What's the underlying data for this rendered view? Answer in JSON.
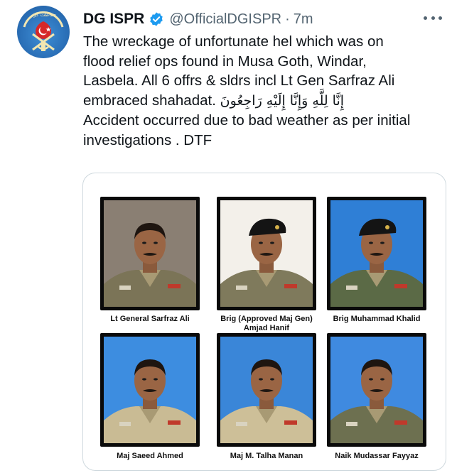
{
  "tweet": {
    "author_name": "DG ISPR",
    "handle": "@OfficialDGISPR",
    "separator": "·",
    "time": "7m",
    "verified": true,
    "text_lines": [
      "The wreckage of unfortunate hel which was on",
      "flood relief ops found in Musa Goth, Windar,",
      "Lasbela. All 6 offrs & sldrs incl Lt Gen Sarfraz Ali",
      "embraced shahadat.",
      "Accident occurred due to bad weather as per initial",
      "investigations . DTF"
    ],
    "arabic_text": "إِنَّا لِلَّهِ وَإِنَّا إِلَيْهِ رَاجِعُونَ"
  },
  "avatar": {
    "icon": "isp-crest-icon",
    "top_arc_text": "حفاظت کرم"
  },
  "media": {
    "photos": [
      {
        "caption_lines": [
          "Lt General Sarfraz Ali"
        ],
        "background": "#8a7f73",
        "uniform": "#7b7457",
        "headwear": "none"
      },
      {
        "caption_lines": [
          "Brig (Approved Maj Gen)",
          "Amjad Hanif"
        ],
        "background": "#f3f0ea",
        "uniform": "#7f7a5c",
        "headwear": "beret"
      },
      {
        "caption_lines": [
          "Brig Muhammad Khalid"
        ],
        "background": "#2f7fd6",
        "uniform": "#5b6a46",
        "headwear": "beret"
      },
      {
        "caption_lines": [
          "Maj Saeed Ahmed"
        ],
        "background": "#3d8de0",
        "uniform": "#c9bb94",
        "headwear": "none"
      },
      {
        "caption_lines": [
          "Maj M. Talha Manan"
        ],
        "background": "#3a86d8",
        "uniform": "#cdbf98",
        "headwear": "none"
      },
      {
        "caption_lines": [
          "Naik Mudassar Fayyaz"
        ],
        "background": "#3f8ae0",
        "uniform": "#6d7050",
        "headwear": "none"
      }
    ]
  },
  "colors": {
    "verified": "#1d9bf0",
    "secondary_text": "#536471",
    "border": "#cfd9de"
  }
}
